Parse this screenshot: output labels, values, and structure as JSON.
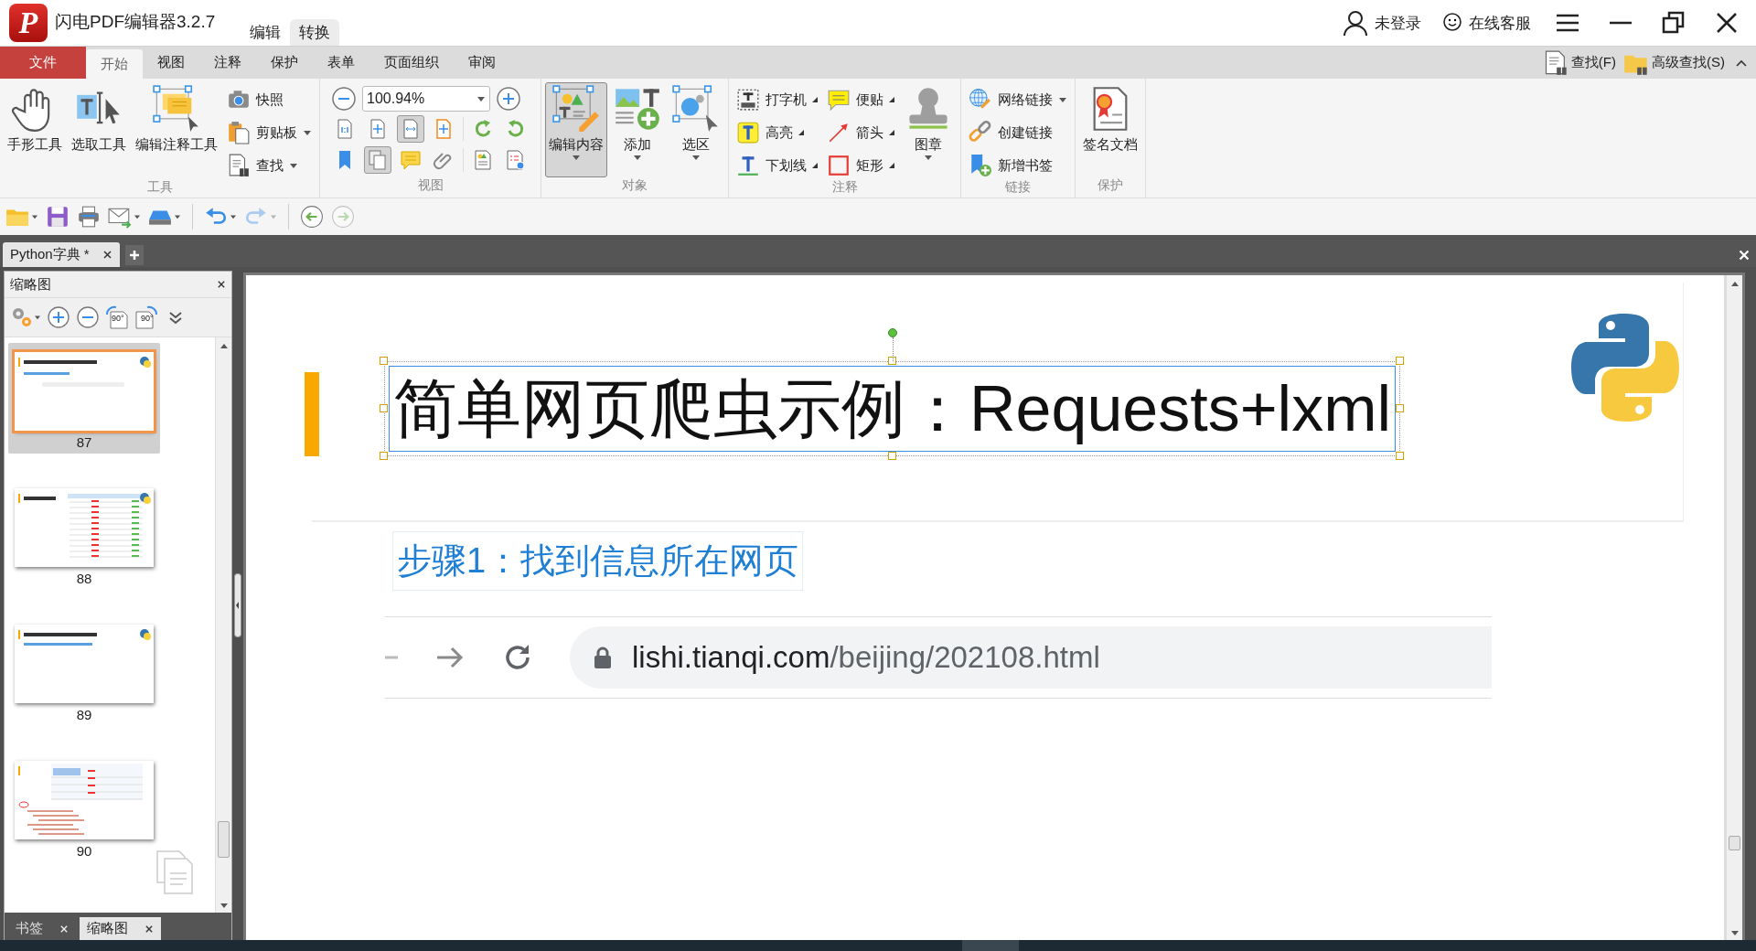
{
  "window": {
    "logo": "P",
    "title": "闪电PDF编辑器3.2.7",
    "context_tabs": [
      {
        "label": "编辑",
        "selected": false
      },
      {
        "label": "转换",
        "selected": true
      }
    ],
    "account": "未登录",
    "support": "在线客服"
  },
  "ribbon": {
    "tabs": [
      {
        "label": "文件",
        "kind": "file",
        "selected": false
      },
      {
        "label": "开始",
        "kind": "tab",
        "selected": true
      },
      {
        "label": "视图",
        "kind": "tab",
        "selected": false
      },
      {
        "label": "注释",
        "kind": "tab",
        "selected": false
      },
      {
        "label": "保护",
        "kind": "tab",
        "selected": false
      },
      {
        "label": "表单",
        "kind": "tab",
        "selected": false
      },
      {
        "label": "页面组织",
        "kind": "tab",
        "selected": false
      },
      {
        "label": "审阅",
        "kind": "tab",
        "selected": false
      }
    ],
    "search": [
      "查找(F)",
      "高级查找(S)"
    ],
    "groups": [
      {
        "label": "工具",
        "columns": [
          {
            "kind": "large",
            "items": [
              {
                "label": "手形工具",
                "dropdown": false,
                "pressed": false
              }
            ]
          },
          {
            "kind": "large",
            "items": [
              {
                "label": "选取工具",
                "dropdown": false,
                "pressed": false
              }
            ]
          },
          {
            "kind": "large",
            "items": [
              {
                "label": "编辑注释工具",
                "dropdown": false,
                "pressed": false
              }
            ]
          },
          {
            "kind": "stack",
            "items": [
              {
                "label": "快照",
                "dropdown": false
              },
              {
                "label": "剪贴板",
                "dropdown": true
              },
              {
                "label": "查找",
                "dropdown": true
              }
            ]
          }
        ]
      },
      {
        "label": "视图",
        "columns": [
          {
            "kind": "zoom",
            "value": "100.94%",
            "buttons": [
              {
                "pressed": false
              },
              {
                "pressed": false
              },
              {
                "pressed": true
              },
              {
                "pressed": false
              },
              {
                "pressed": false
              },
              {
                "pressed": false
              },
              {
                "pressed": false
              },
              {
                "pressed": true
              },
              {
                "pressed": false
              },
              {
                "pressed": false
              },
              {
                "pressed": false
              },
              {
                "pressed": false
              }
            ]
          }
        ]
      },
      {
        "label": "对象",
        "columns": [
          {
            "kind": "large",
            "items": [
              {
                "label": "编辑内容",
                "dropdown": true,
                "pressed": true
              }
            ]
          },
          {
            "kind": "large",
            "items": [
              {
                "label": "添加",
                "dropdown": true,
                "pressed": false
              }
            ]
          },
          {
            "kind": "large",
            "items": [
              {
                "label": "选区",
                "dropdown": true,
                "pressed": false
              }
            ]
          }
        ]
      },
      {
        "label": "注释",
        "columns": [
          {
            "kind": "menus",
            "items": [
              {
                "label": "打字机",
                "dropdown": true
              },
              {
                "label": "高亮",
                "dropdown": true
              },
              {
                "label": "下划线",
                "dropdown": true
              }
            ]
          },
          {
            "kind": "menus",
            "items": [
              {
                "label": "便贴",
                "dropdown": true
              },
              {
                "label": "箭头",
                "dropdown": true
              },
              {
                "label": "矩形",
                "dropdown": true
              }
            ]
          },
          {
            "kind": "large",
            "items": [
              {
                "label": "图章",
                "dropdown": true,
                "pressed": false
              }
            ]
          }
        ]
      },
      {
        "label": "链接",
        "columns": [
          {
            "kind": "stack",
            "items": [
              {
                "label": "网络链接",
                "dropdown": true
              },
              {
                "label": "创建链接",
                "dropdown": false
              },
              {
                "label": "新增书签",
                "dropdown": false
              }
            ]
          }
        ]
      },
      {
        "label": "保护",
        "columns": [
          {
            "kind": "large",
            "items": [
              {
                "label": "签名文档",
                "dropdown": false,
                "pressed": false
              }
            ]
          }
        ]
      }
    ]
  },
  "quick_tools": [
    {
      "dropdown": true,
      "disabled": false
    },
    {
      "dropdown": false,
      "disabled": false
    },
    {
      "dropdown": false,
      "disabled": false
    },
    {
      "dropdown": true,
      "disabled": false
    },
    {
      "dropdown": true,
      "disabled": false
    },
    {
      "dropdown": true,
      "disabled": false
    },
    {
      "dropdown": true,
      "disabled": true
    },
    {
      "dropdown": false,
      "disabled": false
    },
    {
      "dropdown": false,
      "disabled": true
    }
  ],
  "doc_tabs": [
    {
      "label": "Python字典 *",
      "selected": true
    }
  ],
  "sidebar": {
    "title": "缩略图",
    "tools": [
      {
        "kind": "options"
      },
      {
        "kind": "zoom-in"
      },
      {
        "kind": "zoom-out"
      },
      {
        "kind": "rotate-left",
        "label": "90°"
      },
      {
        "kind": "rotate-right",
        "label": "90°"
      },
      {
        "kind": "more"
      }
    ],
    "thumbnails": [
      {
        "label": "87",
        "kind": "slide",
        "selected": true
      },
      {
        "label": "88",
        "kind": "table",
        "selected": false
      },
      {
        "label": "89",
        "kind": "heading",
        "selected": false
      },
      {
        "label": "90",
        "kind": "code",
        "selected": false
      }
    ],
    "tabs": [
      {
        "label": "书签",
        "selected": false
      },
      {
        "label": "缩略图",
        "selected": true
      }
    ]
  },
  "page": {
    "title": "简单网页爬虫示例：Requests+lxml",
    "title_selected": true,
    "subtitle": "步骤1：找到信息所在网页",
    "url_domain": "lishi.tianqi.com",
    "url_path": "/beijing/202108.html"
  }
}
